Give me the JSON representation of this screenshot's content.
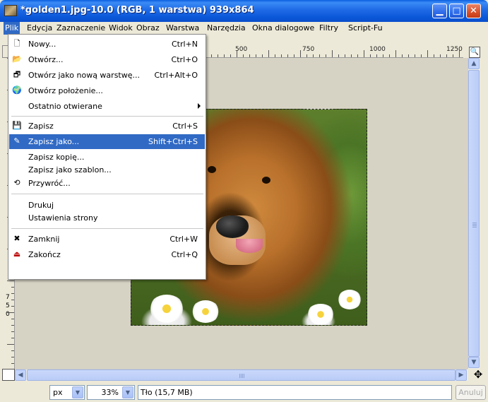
{
  "window": {
    "title": "*golden1.jpg-10.0 (RGB, 1 warstwa) 939x864",
    "minimize_glyph": "▁",
    "maximize_glyph": "□",
    "close_glyph": "✕"
  },
  "menubar": {
    "items": [
      "Plik",
      "Edycja",
      "Zaznaczenie",
      "Widok",
      "Obraz",
      "Warstwa",
      "Narzędzia",
      "Okna dialogowe",
      "Filtry",
      "Script-Fu"
    ],
    "active": "Plik"
  },
  "ruler": {
    "h_labels": [
      "500",
      "750",
      "1000",
      "1250"
    ],
    "v_labels": [
      "7",
      "5",
      "0"
    ]
  },
  "file_menu": {
    "items": [
      {
        "label": "Nowy...",
        "shortcut": "Ctrl+N",
        "icon": "new-document-icon"
      },
      {
        "label": "Otwórz...",
        "shortcut": "Ctrl+O",
        "icon": "open-folder-icon"
      },
      {
        "label": "Otwórz jako nową warstwę...",
        "shortcut": "Ctrl+Alt+O",
        "icon": "open-as-layer-icon"
      },
      {
        "label": "Otwórz położenie...",
        "shortcut": "",
        "icon": "globe-icon"
      },
      {
        "label": "Ostatnio otwierane",
        "shortcut": "",
        "icon": ""
      },
      {
        "label": "Zapisz",
        "shortcut": "Ctrl+S",
        "icon": "save-icon"
      },
      {
        "label": "Zapisz jako...",
        "shortcut": "Shift+Ctrl+S",
        "icon": "save-as-icon"
      },
      {
        "label": "Zapisz kopię...",
        "shortcut": "",
        "icon": ""
      },
      {
        "label": "Zapisz jako szablon...",
        "shortcut": "",
        "icon": ""
      },
      {
        "label": "Przywróć...",
        "shortcut": "",
        "icon": "revert-icon"
      },
      {
        "label": "Drukuj",
        "shortcut": "",
        "icon": ""
      },
      {
        "label": "Ustawienia strony",
        "shortcut": "",
        "icon": ""
      },
      {
        "label": "Zamknij",
        "shortcut": "Ctrl+W",
        "icon": "close-x-icon"
      },
      {
        "label": "Zakończ",
        "shortcut": "Ctrl+Q",
        "icon": "quit-icon"
      }
    ],
    "highlighted": "Zapisz jako..."
  },
  "statusbar": {
    "unit": "px",
    "zoom": "33%",
    "message": "Tło (15,7 MB)",
    "cancel_label": "Anuluj"
  },
  "colors": {
    "menu_highlight": "#316AC5",
    "titlebar": "#0A57D8"
  }
}
